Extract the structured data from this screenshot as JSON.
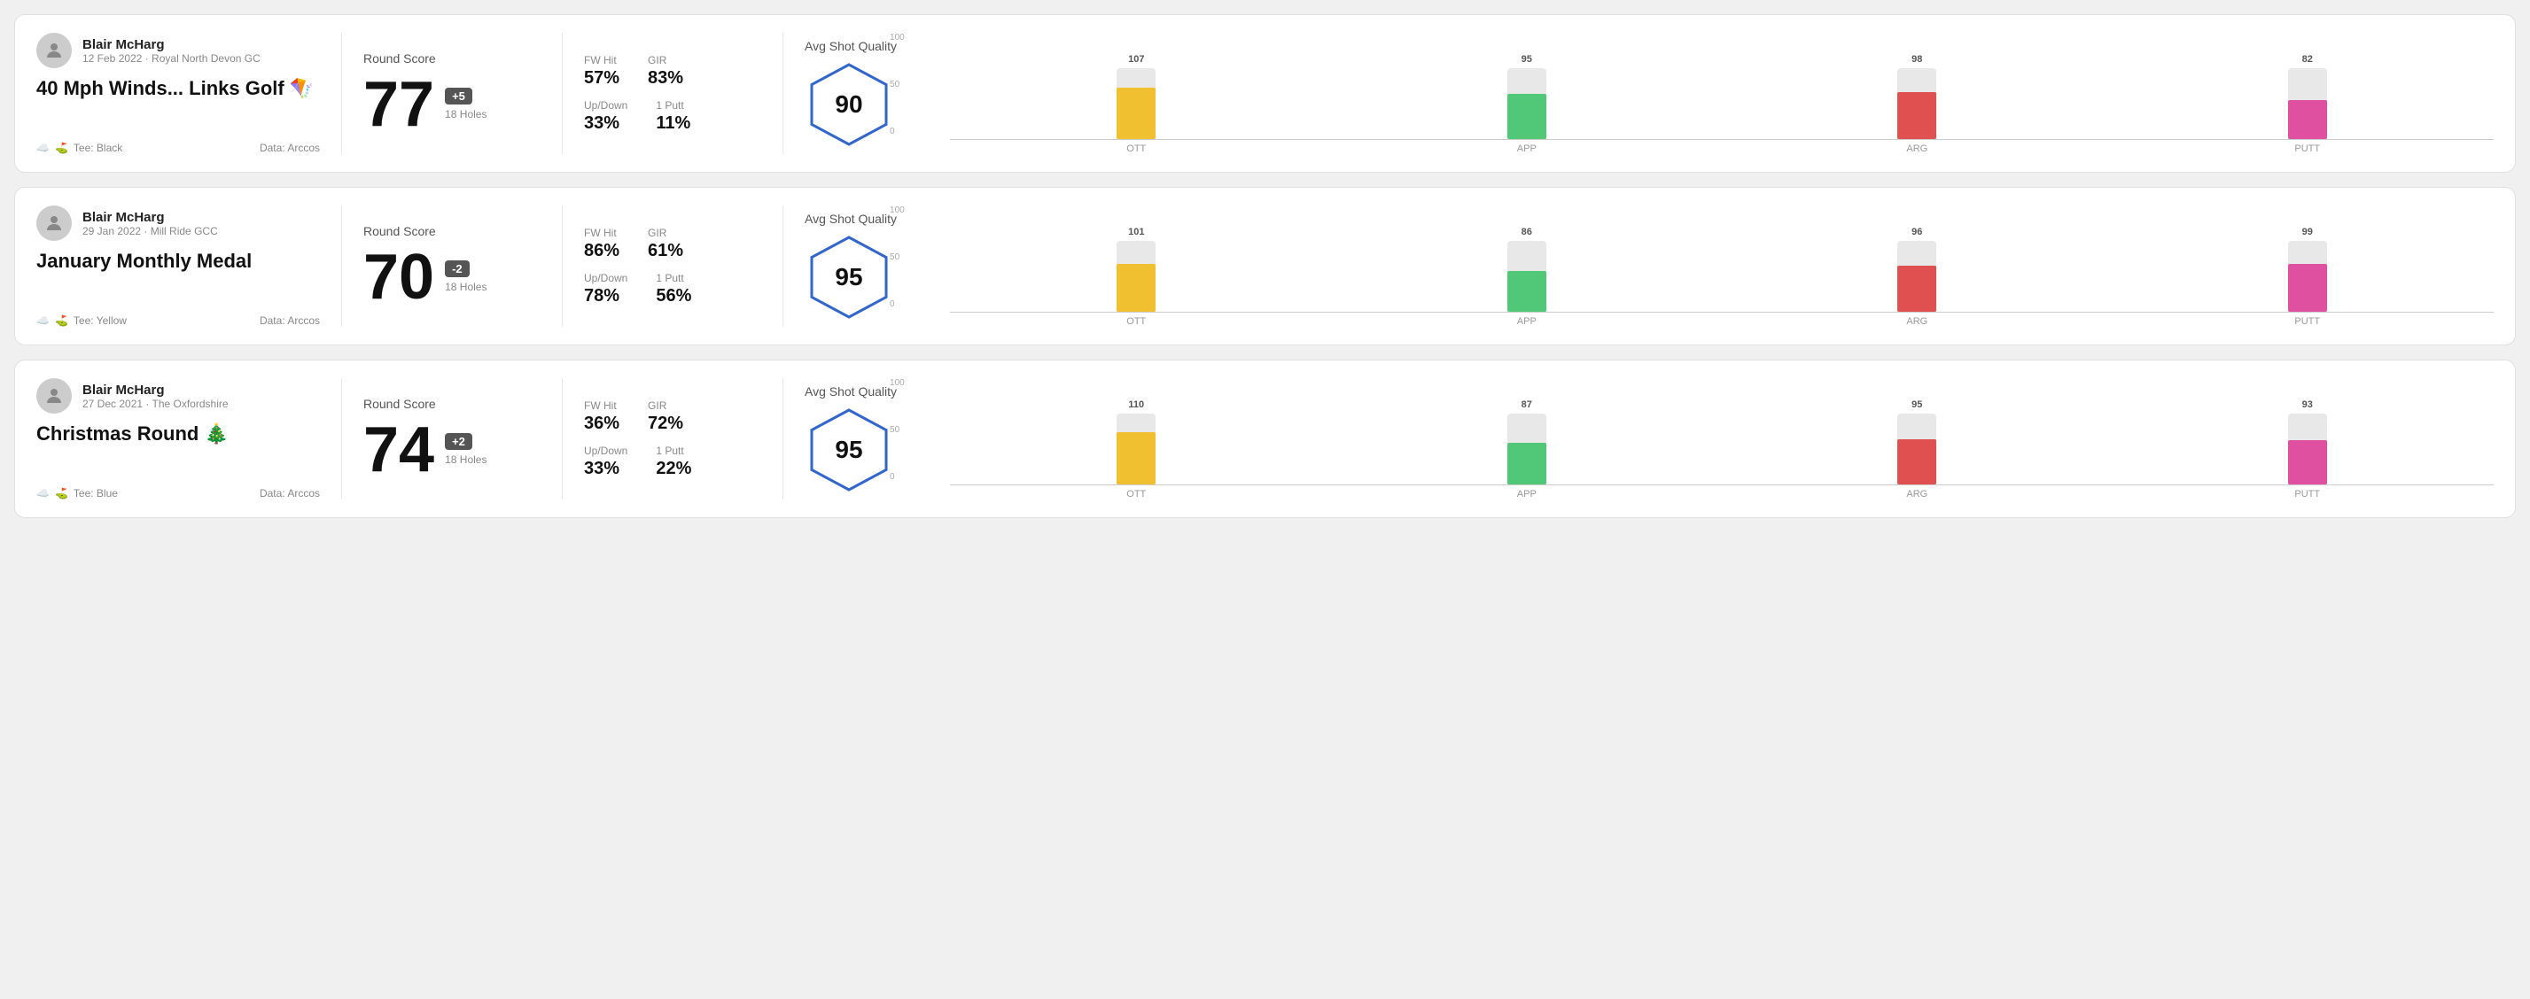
{
  "rounds": [
    {
      "id": "round-1",
      "user": {
        "name": "Blair McHarg",
        "date": "12 Feb 2022 · Royal North Devon GC"
      },
      "title": "40 Mph Winds... Links Golf 🪁",
      "tee": "Black",
      "data_source": "Data: Arccos",
      "score": {
        "label": "Round Score",
        "number": "77",
        "badge": "+5",
        "holes": "18 Holes"
      },
      "stats": {
        "fw_hit_label": "FW Hit",
        "fw_hit_value": "57%",
        "gir_label": "GIR",
        "gir_value": "83%",
        "updown_label": "Up/Down",
        "updown_value": "33%",
        "oneputt_label": "1 Putt",
        "oneputt_value": "11%"
      },
      "quality": {
        "label": "Avg Shot Quality",
        "score": "90"
      },
      "chart": {
        "bars": [
          {
            "label": "OTT",
            "value": 107,
            "color": "#f0c030",
            "bar_pct": 72
          },
          {
            "label": "APP",
            "value": 95,
            "color": "#50c878",
            "bar_pct": 64
          },
          {
            "label": "ARG",
            "value": 98,
            "color": "#e05050",
            "bar_pct": 66
          },
          {
            "label": "PUTT",
            "value": 82,
            "color": "#e050a0",
            "bar_pct": 55
          }
        ]
      }
    },
    {
      "id": "round-2",
      "user": {
        "name": "Blair McHarg",
        "date": "29 Jan 2022 · Mill Ride GCC"
      },
      "title": "January Monthly Medal",
      "tee": "Yellow",
      "data_source": "Data: Arccos",
      "score": {
        "label": "Round Score",
        "number": "70",
        "badge": "-2",
        "holes": "18 Holes"
      },
      "stats": {
        "fw_hit_label": "FW Hit",
        "fw_hit_value": "86%",
        "gir_label": "GIR",
        "gir_value": "61%",
        "updown_label": "Up/Down",
        "updown_value": "78%",
        "oneputt_label": "1 Putt",
        "oneputt_value": "56%"
      },
      "quality": {
        "label": "Avg Shot Quality",
        "score": "95"
      },
      "chart": {
        "bars": [
          {
            "label": "OTT",
            "value": 101,
            "color": "#f0c030",
            "bar_pct": 68
          },
          {
            "label": "APP",
            "value": 86,
            "color": "#50c878",
            "bar_pct": 58
          },
          {
            "label": "ARG",
            "value": 96,
            "color": "#e05050",
            "bar_pct": 65
          },
          {
            "label": "PUTT",
            "value": 99,
            "color": "#e050a0",
            "bar_pct": 67
          }
        ]
      }
    },
    {
      "id": "round-3",
      "user": {
        "name": "Blair McHarg",
        "date": "27 Dec 2021 · The Oxfordshire"
      },
      "title": "Christmas Round 🎄",
      "tee": "Blue",
      "data_source": "Data: Arccos",
      "score": {
        "label": "Round Score",
        "number": "74",
        "badge": "+2",
        "holes": "18 Holes"
      },
      "stats": {
        "fw_hit_label": "FW Hit",
        "fw_hit_value": "36%",
        "gir_label": "GIR",
        "gir_value": "72%",
        "updown_label": "Up/Down",
        "updown_value": "33%",
        "oneputt_label": "1 Putt",
        "oneputt_value": "22%"
      },
      "quality": {
        "label": "Avg Shot Quality",
        "score": "95"
      },
      "chart": {
        "bars": [
          {
            "label": "OTT",
            "value": 110,
            "color": "#f0c030",
            "bar_pct": 74
          },
          {
            "label": "APP",
            "value": 87,
            "color": "#50c878",
            "bar_pct": 59
          },
          {
            "label": "ARG",
            "value": 95,
            "color": "#e05050",
            "bar_pct": 64
          },
          {
            "label": "PUTT",
            "value": 93,
            "color": "#e050a0",
            "bar_pct": 63
          }
        ]
      }
    }
  ],
  "y_axis_labels": [
    "100",
    "50",
    "0"
  ]
}
